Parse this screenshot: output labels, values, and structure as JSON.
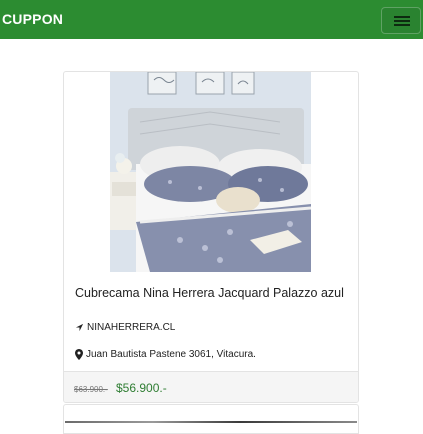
{
  "app": {
    "brand": "CUPPON"
  },
  "colors": {
    "navbar": "#2c8c31",
    "price": "#2e7d32"
  },
  "product": {
    "title": "Cubrecama Nina Herrera Jacquard Palazzo azul",
    "site_icon": "location-arrow-icon",
    "site": "NINAHERRERA.CL",
    "address_icon": "map-marker-icon",
    "address": "Juan Bautista Pastene 3061, Vitacura.",
    "old_price": "$63.900.-",
    "new_price": "$56.900.-"
  }
}
